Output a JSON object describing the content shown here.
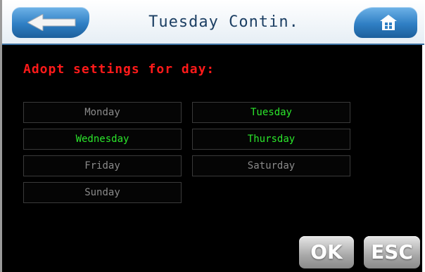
{
  "header": {
    "title": "Tuesday Contin.",
    "back_icon": "arrow-left-icon",
    "home_icon": "home-icon"
  },
  "prompt": "Adopt settings for day:",
  "days": [
    {
      "label": "Monday",
      "active": false
    },
    {
      "label": "Tuesday",
      "active": true
    },
    {
      "label": "Wednesday",
      "active": true
    },
    {
      "label": "Thursday",
      "active": true
    },
    {
      "label": "Friday",
      "active": false
    },
    {
      "label": "Saturday",
      "active": false
    },
    {
      "label": "Sunday",
      "active": false
    }
  ],
  "buttons": {
    "ok": "OK",
    "esc": "ESC"
  },
  "colors": {
    "prompt": "#ff1a1a",
    "active_day": "#2be62b",
    "inactive_day": "#8a8a8a",
    "header_accent": "#2f7fc4"
  }
}
